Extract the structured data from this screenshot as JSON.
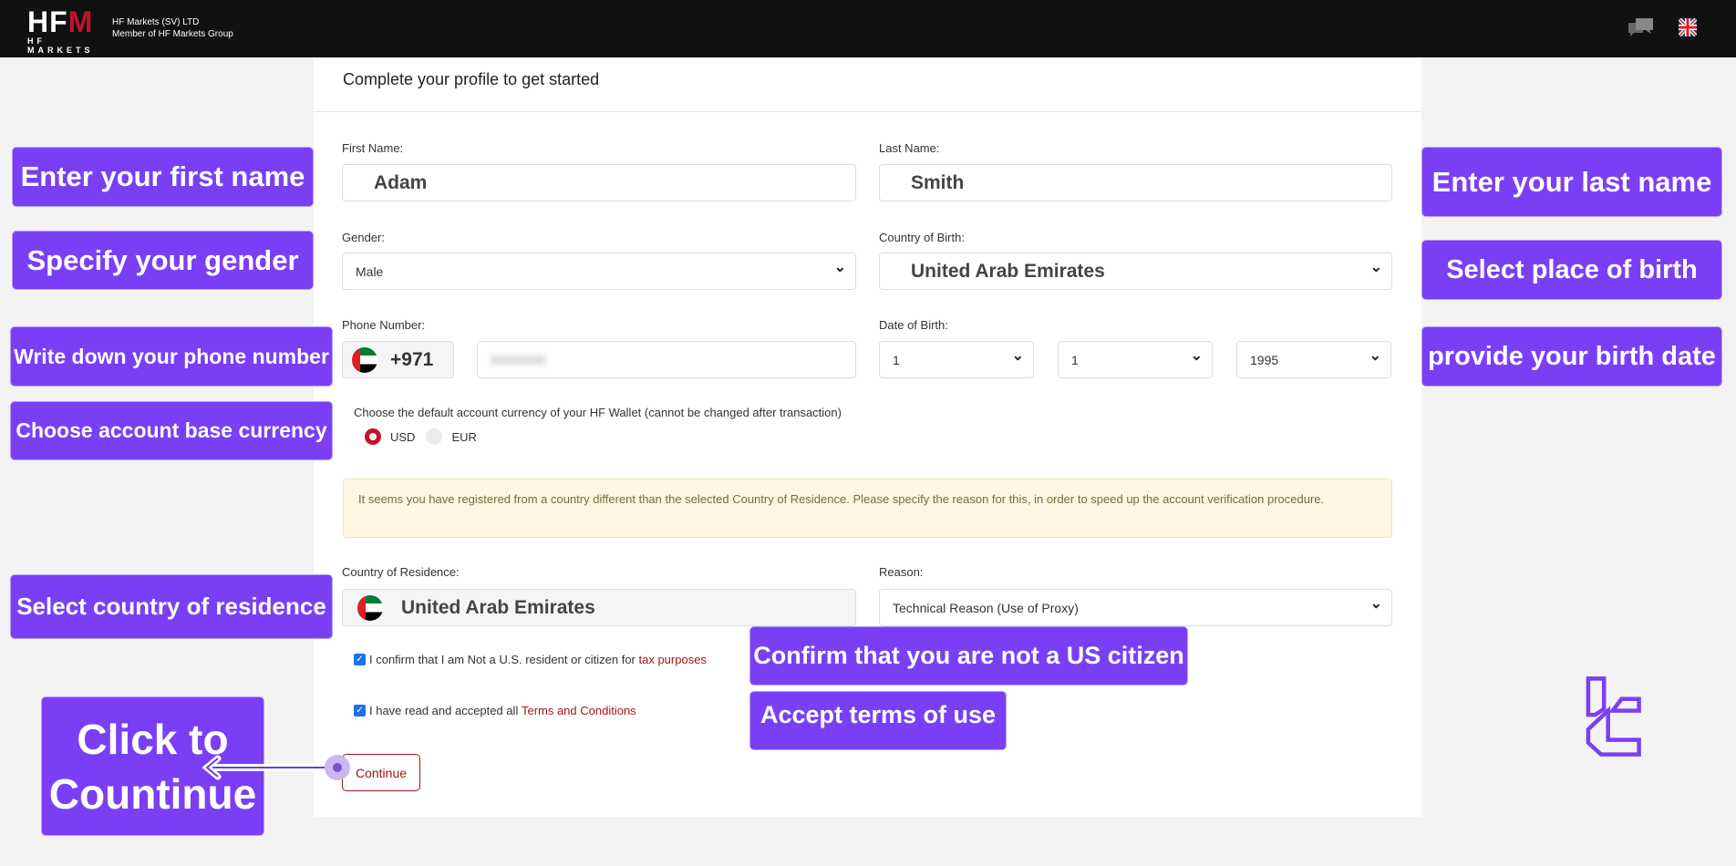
{
  "header": {
    "logo_text": "HFM",
    "logo_sub": "HF MARKETS",
    "company": "HF Markets (SV) LTD",
    "group": "Member of HF Markets Group",
    "icons": [
      "chat-icon",
      "uk-flag-icon"
    ]
  },
  "form": {
    "title": "Complete your profile to get started",
    "first_name": {
      "label": "First Name:",
      "value": "Adam"
    },
    "last_name": {
      "label": "Last Name:",
      "value": "Smith"
    },
    "gender": {
      "label": "Gender:",
      "value": "Male"
    },
    "country_of_birth": {
      "label": "Country of Birth:",
      "value": "United Arab Emirates"
    },
    "phone": {
      "label": "Phone Number:",
      "code": "+971",
      "value": ""
    },
    "dob": {
      "label": "Date of Birth:",
      "day": "1",
      "month": "1",
      "year": "1995"
    },
    "currency": {
      "label": "Choose the default account currency of your HF Wallet (cannot be changed after transaction)",
      "options": [
        "USD",
        "EUR"
      ],
      "selected": "USD"
    },
    "warning": "It seems you have registered from a country different than the selected Country of Residence. Please specify the reason for this, in order to speed up the account verification procedure.",
    "residence": {
      "label": "Country of Residence:",
      "value": "United Arab Emirates"
    },
    "reason": {
      "label": "Reason:",
      "value": "Technical Reason (Use of Proxy)"
    },
    "confirm_us": {
      "text": "I confirm that I am Not a U.S. resident or citizen for ",
      "link": "tax purposes",
      "checked": true
    },
    "terms": {
      "text": "I have read and accepted all ",
      "link": "Terms and Conditions",
      "checked": true
    },
    "continue": "Continue"
  },
  "annotations": {
    "first_name": "Enter your first name",
    "gender": "Specify your gender",
    "phone": "Write down your phone number",
    "currency": "Choose account base currency",
    "residence": "Select country of residence",
    "continue": "Click to Countinue",
    "last_name": "Enter your last name",
    "birth_place": "Select place of birth",
    "birth_date": "provide your birth date",
    "us_citizen": "Confirm that you are not a US citizen",
    "terms": "Accept terms of use"
  },
  "colors": {
    "annotation": "#7a3ff5",
    "brand_red": "#a31515",
    "header": "#111111"
  }
}
